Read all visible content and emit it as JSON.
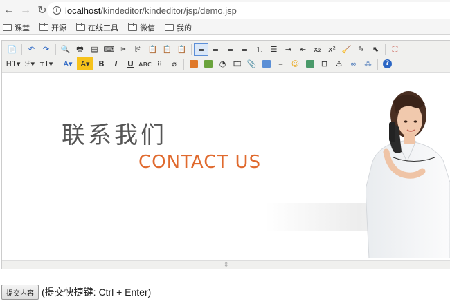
{
  "browser": {
    "url_host": "localhost",
    "url_path": "/kindeditor/kindeditor/jsp/demo.jsp",
    "bookmarks": [
      "课堂",
      "开源",
      "在线工具",
      "微信",
      "我的"
    ]
  },
  "toolbar": {
    "row1": [
      {
        "name": "source-icon",
        "glyph": "📄"
      },
      "sep",
      {
        "name": "undo-icon",
        "glyph": "↶",
        "color": "#2b66c4"
      },
      {
        "name": "redo-icon",
        "glyph": "↷",
        "color": "#2b66c4"
      },
      "sep",
      {
        "name": "preview-icon",
        "glyph": "🔍"
      },
      {
        "name": "print-icon",
        "glyph": "🖶"
      },
      {
        "name": "template-icon",
        "glyph": "▤"
      },
      {
        "name": "code-icon",
        "glyph": "⌨"
      },
      {
        "name": "cut-icon",
        "glyph": "✂"
      },
      {
        "name": "copy-icon",
        "glyph": "⎘"
      },
      {
        "name": "paste-icon",
        "glyph": "📋"
      },
      {
        "name": "paste-plain-icon",
        "glyph": "📋"
      },
      {
        "name": "paste-word-icon",
        "glyph": "📋"
      },
      "sep",
      {
        "name": "align-left-icon",
        "glyph": "≡",
        "active": true
      },
      {
        "name": "align-center-icon",
        "glyph": "≡"
      },
      {
        "name": "align-right-icon",
        "glyph": "≡"
      },
      {
        "name": "align-justify-icon",
        "glyph": "≡"
      },
      {
        "name": "ordered-list-icon",
        "glyph": "⒈"
      },
      {
        "name": "unordered-list-icon",
        "glyph": "☰"
      },
      {
        "name": "indent-icon",
        "glyph": "⇥"
      },
      {
        "name": "outdent-icon",
        "glyph": "⇤"
      },
      {
        "name": "subscript-icon",
        "glyph": "x₂"
      },
      {
        "name": "superscript-icon",
        "glyph": "x²"
      },
      {
        "name": "clear-format-icon",
        "glyph": "🧹"
      },
      {
        "name": "quick-format-icon",
        "glyph": "✎"
      },
      {
        "name": "select-all-icon",
        "glyph": "⬉"
      },
      "sep",
      {
        "name": "fullscreen-icon",
        "glyph": "⛶",
        "color": "#c0392b"
      }
    ],
    "row2": [
      {
        "name": "heading-icon",
        "glyph": "H1▾",
        "wide": true
      },
      {
        "name": "font-family-icon",
        "glyph": "ℱ▾",
        "wide": true
      },
      {
        "name": "font-size-icon",
        "glyph": "ᴛT▾",
        "wide": true
      },
      "sep",
      {
        "name": "font-color-icon",
        "glyph": "A▾",
        "color": "#2b66c4",
        "wide": true
      },
      {
        "name": "highlight-color-icon",
        "glyph": "A▾",
        "bg": "#f6c21b",
        "wide": true
      },
      {
        "name": "bold-icon",
        "glyph": "B",
        "bold": true
      },
      {
        "name": "italic-icon",
        "glyph": "I",
        "italic": true
      },
      {
        "name": "underline-icon",
        "glyph": "U",
        "underline": true
      },
      {
        "name": "strikethrough-icon",
        "glyph": "ᴀʙᴄ"
      },
      {
        "name": "line-height-icon",
        "glyph": "⁞⁞"
      },
      {
        "name": "remove-format-icon",
        "glyph": "⌀"
      },
      "sep",
      {
        "name": "image-icon",
        "glyph": "",
        "sq": "#e0792a"
      },
      {
        "name": "multi-image-icon",
        "glyph": "",
        "sq": "#6aa33c"
      },
      {
        "name": "flash-icon",
        "glyph": "◔"
      },
      {
        "name": "media-icon",
        "glyph": "🎞"
      },
      {
        "name": "insert-file-icon",
        "glyph": "📎"
      },
      {
        "name": "table-icon",
        "glyph": "",
        "sq": "#5b8fd6"
      },
      {
        "name": "horizontal-rule-icon",
        "glyph": "⎯"
      },
      {
        "name": "emoticons-icon",
        "glyph": "☺",
        "color": "#e8a20c"
      },
      {
        "name": "baidu-map-icon",
        "glyph": "",
        "sq": "#4a9a6a"
      },
      {
        "name": "page-break-icon",
        "glyph": "⊟"
      },
      {
        "name": "anchor-icon",
        "glyph": "⚓"
      },
      {
        "name": "link-icon",
        "glyph": "∞",
        "color": "#3d6fb5"
      },
      {
        "name": "unlink-icon",
        "glyph": "⁂",
        "color": "#3d6fb5"
      },
      "sep",
      {
        "name": "about-icon",
        "glyph": "?",
        "circle": "#2b66c4"
      }
    ]
  },
  "content": {
    "cn_title": "联系我们",
    "en_title": "CONTACT US"
  },
  "footer": {
    "submit_label": "提交内容",
    "hint": "(提交快捷键: Ctrl + Enter)"
  }
}
